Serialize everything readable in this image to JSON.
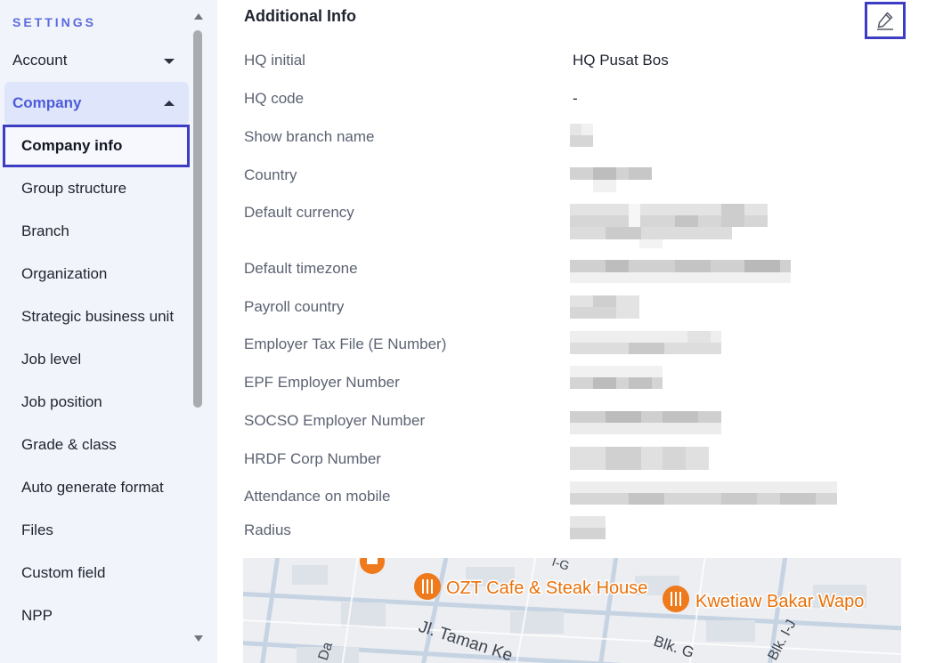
{
  "sidebar": {
    "heading": "SETTINGS",
    "account_label": "Account",
    "company_label": "Company",
    "items": [
      {
        "label": "Company info"
      },
      {
        "label": "Group structure"
      },
      {
        "label": "Branch"
      },
      {
        "label": "Organization"
      },
      {
        "label": "Strategic business unit"
      },
      {
        "label": "Job level"
      },
      {
        "label": "Job position"
      },
      {
        "label": "Grade & class"
      },
      {
        "label": "Auto generate format"
      },
      {
        "label": "Files"
      },
      {
        "label": "Custom field"
      },
      {
        "label": "NPP"
      }
    ]
  },
  "main": {
    "section_title": "Additional Info",
    "edit_icon": "pencil-icon",
    "fields": [
      {
        "label": "HQ initial",
        "value": "HQ Pusat Bos"
      },
      {
        "label": "HQ code",
        "value": "-"
      },
      {
        "label": "Show branch name"
      },
      {
        "label": "Country"
      },
      {
        "label": "Default currency"
      },
      {
        "label": "Default timezone"
      },
      {
        "label": "Payroll country"
      },
      {
        "label": "Employer Tax File (E Number)"
      },
      {
        "label": "EPF Employer Number"
      },
      {
        "label": "SOCSO Employer Number"
      },
      {
        "label": "HRDF Corp Number"
      },
      {
        "label": "Attendance on mobile"
      },
      {
        "label": "Radius"
      }
    ],
    "map": {
      "places": [
        {
          "name": "OZT Cafe & Steak House"
        },
        {
          "name": "Kwetiaw Bakar Wapo"
        }
      ],
      "streets": [
        "Jl. Taman Ke",
        "Blk. G",
        "Blk. I-J",
        "Da",
        "I-G"
      ]
    }
  },
  "colors": {
    "accent": "#4e5cd8",
    "highlight_border": "#3d3dc4",
    "sidebar_bg": "#f1f4fa",
    "poi_orange": "#e8710a"
  }
}
